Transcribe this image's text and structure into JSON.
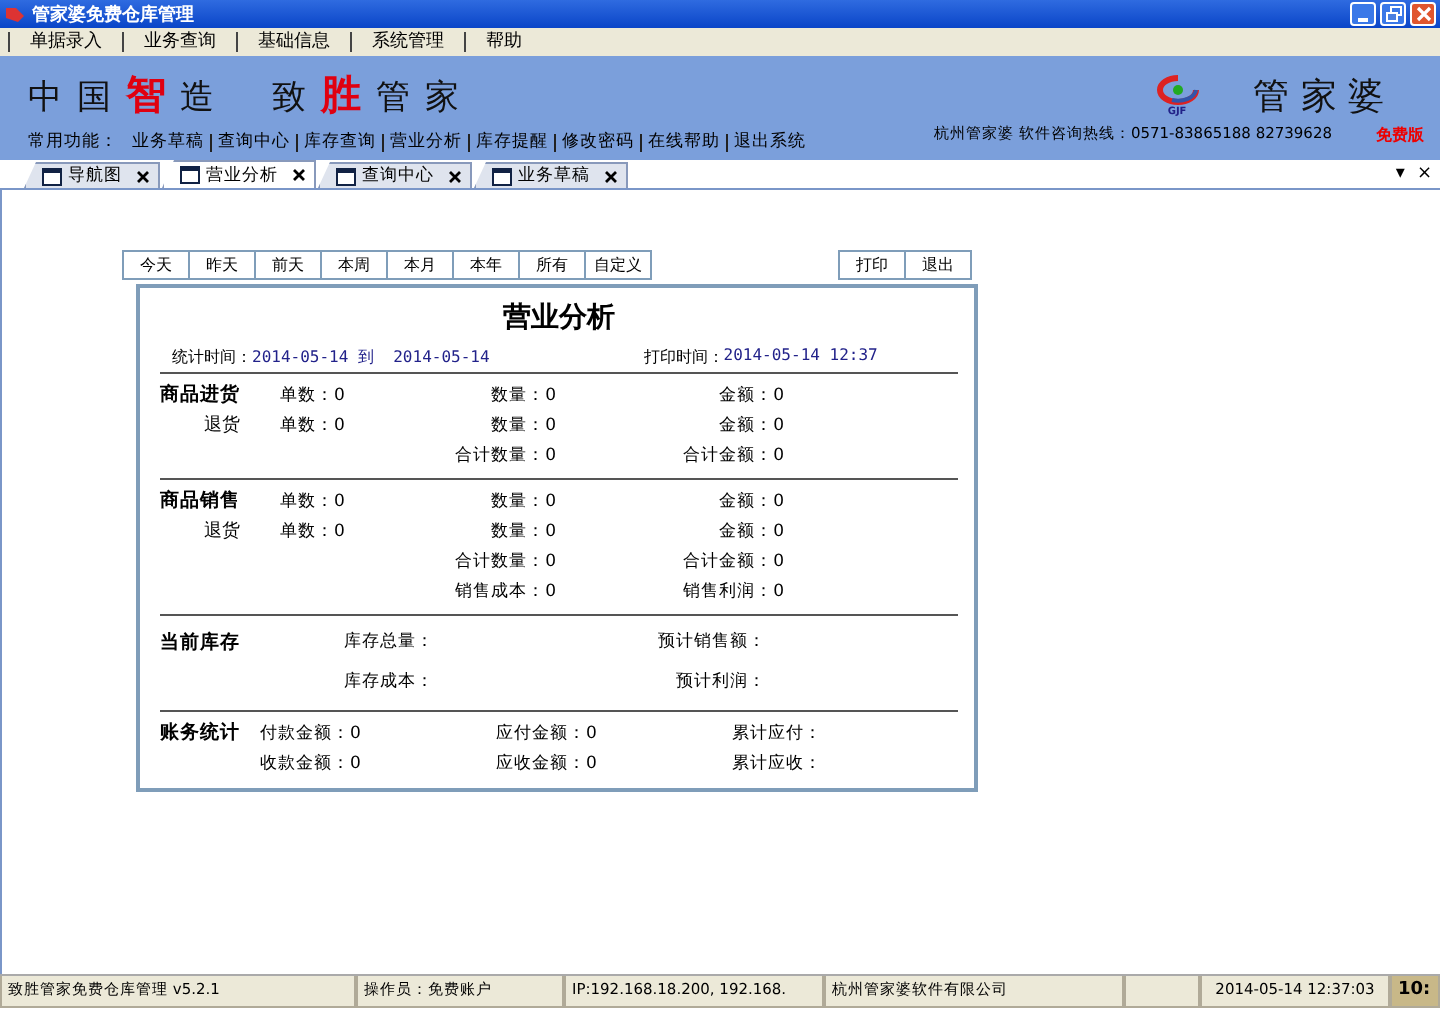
{
  "window": {
    "title": "管家婆免费仓库管理"
  },
  "menu": [
    "单据录入",
    "业务查询",
    "基础信息",
    "系统管理",
    "帮助"
  ],
  "banner": {
    "slogan": [
      [
        {
          "text": "中 国 ",
          "highlight": false
        },
        {
          "text": "智",
          "highlight": true
        },
        {
          "text": " 造",
          "highlight": false
        }
      ],
      [
        {
          "text": "致 ",
          "highlight": false
        },
        {
          "text": "胜",
          "highlight": true
        },
        {
          "text": " 管 家",
          "highlight": false
        }
      ]
    ],
    "quick_label": "常用功能：",
    "quick_links": [
      "业务草稿",
      "查询中心",
      "库存查询",
      "营业分析",
      "库存提醒",
      "修改密码",
      "在线帮助",
      "退出系统"
    ],
    "logo_text": "GJF",
    "brand": "管 家 婆",
    "hotline": "杭州管家婆  软件咨询热线：0571-83865188 82739628",
    "edition": "免费版"
  },
  "tabs": [
    {
      "label": "导航图",
      "selected": false
    },
    {
      "label": "营业分析",
      "selected": true
    },
    {
      "label": "查询中心",
      "selected": false
    },
    {
      "label": "业务草稿",
      "selected": false
    }
  ],
  "tab_controls": [
    "▾",
    "×"
  ],
  "period_buttons": [
    "今天",
    "昨天",
    "前天",
    "本周",
    "本月",
    "本年",
    "所有",
    "自定义"
  ],
  "actions": [
    "打印",
    "退出"
  ],
  "report": {
    "title": "营业分析",
    "stat_time": {
      "label": "统计时间：",
      "value": "2014-05-14 到  2014-05-14"
    },
    "print_time": {
      "label": "打印时间：",
      "value": "2014-05-14 12:37"
    },
    "sections": [
      {
        "kind": "trade",
        "lines": [
          {
            "label": "商品进货",
            "items": [
              "单数：0",
              "数量：0",
              "金额：0"
            ]
          },
          {
            "label": "退货",
            "items": [
              "单数：0",
              "数量：0",
              "金额：0"
            ]
          },
          {
            "items": [
              "合计数量：0",
              "合计金额：0"
            ]
          }
        ]
      },
      {
        "kind": "trade",
        "lines": [
          {
            "label": "商品销售",
            "items": [
              "单数：0",
              "数量：0",
              "金额：0"
            ]
          },
          {
            "label": "退货",
            "items": [
              "单数：0",
              "数量：0",
              "金额：0"
            ]
          },
          {
            "items": [
              "合计数量：0",
              "合计金额：0"
            ]
          },
          {
            "items": [
              "销售成本：0",
              "销售利润：0"
            ]
          }
        ]
      },
      {
        "kind": "stock",
        "lines": [
          {
            "label": "当前库存",
            "items": [
              "库存总量：",
              "预计销售额："
            ]
          },
          {
            "items": [
              "库存成本：",
              "预计利润："
            ]
          }
        ]
      },
      {
        "kind": "finance",
        "lines": [
          {
            "label": "账务统计",
            "items": [
              "付款金额：0",
              "应付金额：0",
              "累计应付："
            ]
          },
          {
            "items": [
              "收款金额：0",
              "应收金额：0",
              "累计应收："
            ]
          }
        ]
      }
    ]
  },
  "status_bar": [
    "致胜管家免费仓库管理 v5.2.1",
    "操作员：免费账户",
    "IP:192.168.18.200, 192.168.",
    "杭州管家婆软件有限公司",
    "2014-05-14 12:37:03",
    "10:"
  ]
}
